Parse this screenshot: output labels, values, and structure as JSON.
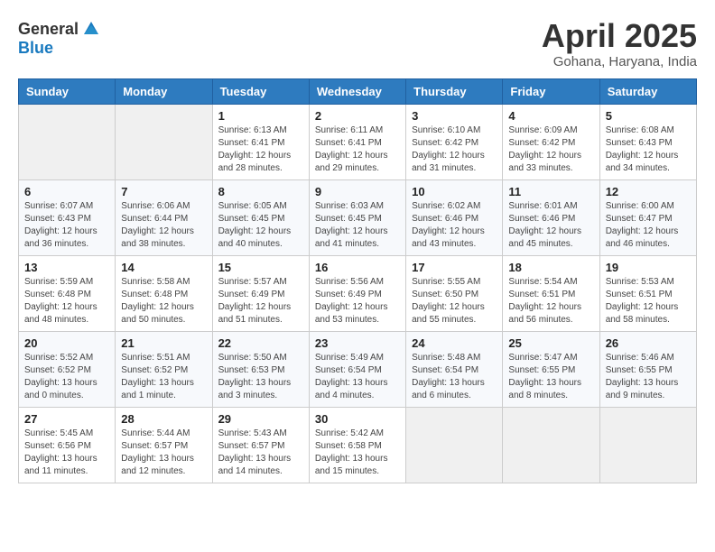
{
  "header": {
    "logo_general": "General",
    "logo_blue": "Blue",
    "month": "April 2025",
    "location": "Gohana, Haryana, India"
  },
  "weekdays": [
    "Sunday",
    "Monday",
    "Tuesday",
    "Wednesday",
    "Thursday",
    "Friday",
    "Saturday"
  ],
  "weeks": [
    [
      {
        "day": "",
        "info": ""
      },
      {
        "day": "",
        "info": ""
      },
      {
        "day": "1",
        "info": "Sunrise: 6:13 AM\nSunset: 6:41 PM\nDaylight: 12 hours and 28 minutes."
      },
      {
        "day": "2",
        "info": "Sunrise: 6:11 AM\nSunset: 6:41 PM\nDaylight: 12 hours and 29 minutes."
      },
      {
        "day": "3",
        "info": "Sunrise: 6:10 AM\nSunset: 6:42 PM\nDaylight: 12 hours and 31 minutes."
      },
      {
        "day": "4",
        "info": "Sunrise: 6:09 AM\nSunset: 6:42 PM\nDaylight: 12 hours and 33 minutes."
      },
      {
        "day": "5",
        "info": "Sunrise: 6:08 AM\nSunset: 6:43 PM\nDaylight: 12 hours and 34 minutes."
      }
    ],
    [
      {
        "day": "6",
        "info": "Sunrise: 6:07 AM\nSunset: 6:43 PM\nDaylight: 12 hours and 36 minutes."
      },
      {
        "day": "7",
        "info": "Sunrise: 6:06 AM\nSunset: 6:44 PM\nDaylight: 12 hours and 38 minutes."
      },
      {
        "day": "8",
        "info": "Sunrise: 6:05 AM\nSunset: 6:45 PM\nDaylight: 12 hours and 40 minutes."
      },
      {
        "day": "9",
        "info": "Sunrise: 6:03 AM\nSunset: 6:45 PM\nDaylight: 12 hours and 41 minutes."
      },
      {
        "day": "10",
        "info": "Sunrise: 6:02 AM\nSunset: 6:46 PM\nDaylight: 12 hours and 43 minutes."
      },
      {
        "day": "11",
        "info": "Sunrise: 6:01 AM\nSunset: 6:46 PM\nDaylight: 12 hours and 45 minutes."
      },
      {
        "day": "12",
        "info": "Sunrise: 6:00 AM\nSunset: 6:47 PM\nDaylight: 12 hours and 46 minutes."
      }
    ],
    [
      {
        "day": "13",
        "info": "Sunrise: 5:59 AM\nSunset: 6:48 PM\nDaylight: 12 hours and 48 minutes."
      },
      {
        "day": "14",
        "info": "Sunrise: 5:58 AM\nSunset: 6:48 PM\nDaylight: 12 hours and 50 minutes."
      },
      {
        "day": "15",
        "info": "Sunrise: 5:57 AM\nSunset: 6:49 PM\nDaylight: 12 hours and 51 minutes."
      },
      {
        "day": "16",
        "info": "Sunrise: 5:56 AM\nSunset: 6:49 PM\nDaylight: 12 hours and 53 minutes."
      },
      {
        "day": "17",
        "info": "Sunrise: 5:55 AM\nSunset: 6:50 PM\nDaylight: 12 hours and 55 minutes."
      },
      {
        "day": "18",
        "info": "Sunrise: 5:54 AM\nSunset: 6:51 PM\nDaylight: 12 hours and 56 minutes."
      },
      {
        "day": "19",
        "info": "Sunrise: 5:53 AM\nSunset: 6:51 PM\nDaylight: 12 hours and 58 minutes."
      }
    ],
    [
      {
        "day": "20",
        "info": "Sunrise: 5:52 AM\nSunset: 6:52 PM\nDaylight: 13 hours and 0 minutes."
      },
      {
        "day": "21",
        "info": "Sunrise: 5:51 AM\nSunset: 6:52 PM\nDaylight: 13 hours and 1 minute."
      },
      {
        "day": "22",
        "info": "Sunrise: 5:50 AM\nSunset: 6:53 PM\nDaylight: 13 hours and 3 minutes."
      },
      {
        "day": "23",
        "info": "Sunrise: 5:49 AM\nSunset: 6:54 PM\nDaylight: 13 hours and 4 minutes."
      },
      {
        "day": "24",
        "info": "Sunrise: 5:48 AM\nSunset: 6:54 PM\nDaylight: 13 hours and 6 minutes."
      },
      {
        "day": "25",
        "info": "Sunrise: 5:47 AM\nSunset: 6:55 PM\nDaylight: 13 hours and 8 minutes."
      },
      {
        "day": "26",
        "info": "Sunrise: 5:46 AM\nSunset: 6:55 PM\nDaylight: 13 hours and 9 minutes."
      }
    ],
    [
      {
        "day": "27",
        "info": "Sunrise: 5:45 AM\nSunset: 6:56 PM\nDaylight: 13 hours and 11 minutes."
      },
      {
        "day": "28",
        "info": "Sunrise: 5:44 AM\nSunset: 6:57 PM\nDaylight: 13 hours and 12 minutes."
      },
      {
        "day": "29",
        "info": "Sunrise: 5:43 AM\nSunset: 6:57 PM\nDaylight: 13 hours and 14 minutes."
      },
      {
        "day": "30",
        "info": "Sunrise: 5:42 AM\nSunset: 6:58 PM\nDaylight: 13 hours and 15 minutes."
      },
      {
        "day": "",
        "info": ""
      },
      {
        "day": "",
        "info": ""
      },
      {
        "day": "",
        "info": ""
      }
    ]
  ]
}
